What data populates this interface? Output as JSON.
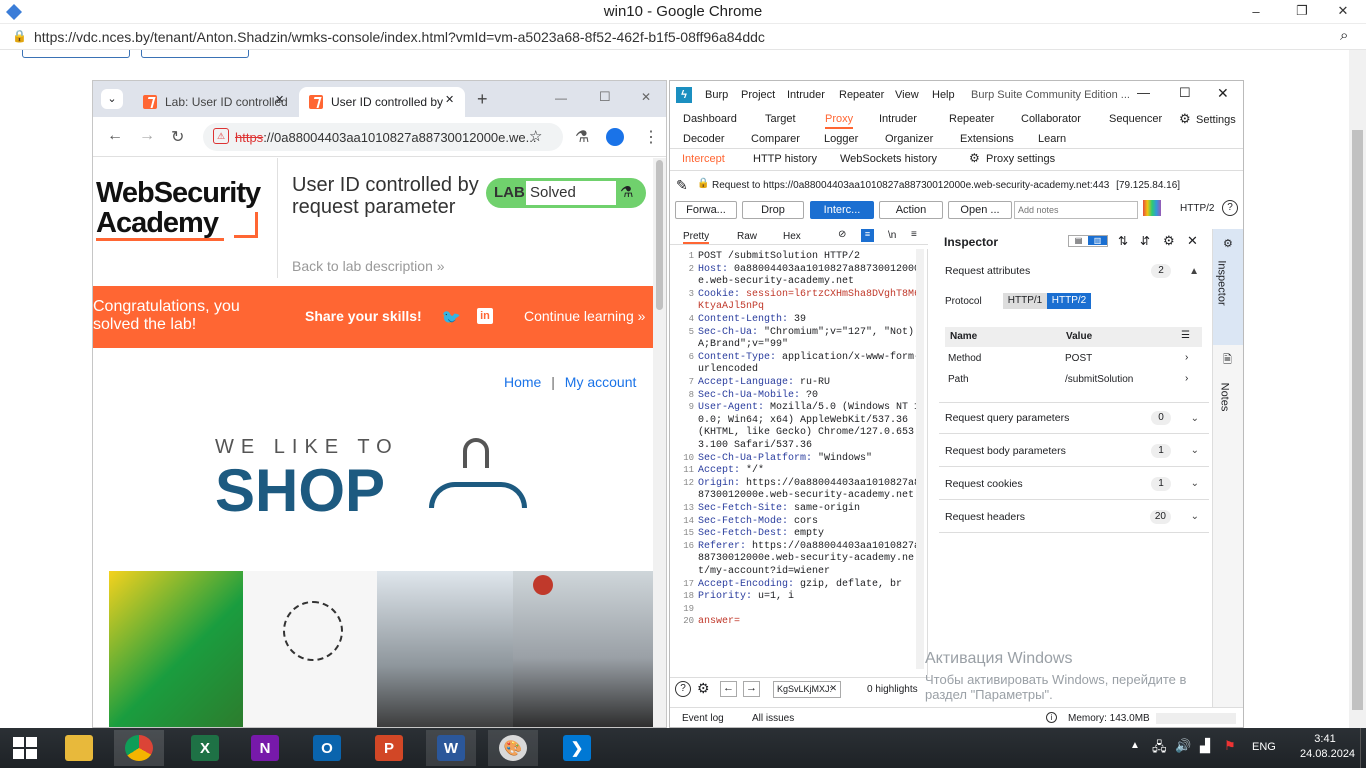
{
  "outer_window": {
    "title": "win10 - Google Chrome",
    "url": "https://vdc.nces.by/tenant/Anton.Shadzin/wmks-console/index.html?vmId=vm-a5023a68-8f52-462f-b1f5-08ff96a84ddc",
    "controls": {
      "min": "–",
      "max": "❐",
      "close": "✕"
    }
  },
  "inner_browser": {
    "tabs": [
      {
        "label": "Lab: User ID controlled"
      },
      {
        "label": "User ID controlled by"
      }
    ],
    "new_tab": "+",
    "url_scheme": "https",
    "url_rest": "://0a88004403aa1010827a88730012000e.we...",
    "page": {
      "logo_line1": "WebSecurity",
      "logo_line2": "Academy",
      "lab_title": "User ID controlled by request parameter",
      "lab_badge": "LAB",
      "lab_status": "Solved",
      "back_link": "Back to lab description",
      "congrats": "Congratulations, you solved the lab!",
      "share": "Share your skills!",
      "continue": "Continue learning",
      "nav_home": "Home",
      "nav_sep": "|",
      "nav_account": "My account",
      "shop_small": "WE LIKE TO",
      "shop_big": "SHOP"
    }
  },
  "burp": {
    "menu": [
      "Burp",
      "Project",
      "Intruder",
      "Repeater",
      "View",
      "Help"
    ],
    "window_title": "Burp Suite Community Edition ...",
    "main_tabs": [
      "Dashboard",
      "Target",
      "Proxy",
      "Intruder",
      "Repeater",
      "Collaborator",
      "Sequencer",
      "Decoder",
      "Comparer",
      "Logger",
      "Organizer",
      "Extensions",
      "Learn"
    ],
    "settings": "Settings",
    "proxy_tabs": [
      "Intercept",
      "HTTP history",
      "WebSockets history"
    ],
    "proxy_settings": "Proxy settings",
    "request_line": "Request to https://0a88004403aa1010827a88730012000e.web-security-academy.net:443",
    "request_ip": "[79.125.84.16]",
    "buttons": {
      "forward": "Forwa...",
      "drop": "Drop",
      "intercept": "Interc...",
      "action": "Action",
      "open": "Open ..."
    },
    "notes_placeholder": "Add notes",
    "http_version": "HTTP/2",
    "editor_tabs": [
      "Pretty",
      "Raw",
      "Hex"
    ],
    "newline_toggle": "\\n",
    "request_lines": [
      {
        "n": "1",
        "text": "POST /submitSolution HTTP/2"
      },
      {
        "n": "2",
        "key": "Host:",
        "val": "0a88004403aa1010827a88730012000e.web-security-academy.net"
      },
      {
        "n": "3",
        "key": "Cookie:",
        "val": "session=l6rtzCXHmSha8DVghT8M6KtyaAJl5nPq"
      },
      {
        "n": "4",
        "key": "Content-Length:",
        "val": "39"
      },
      {
        "n": "5",
        "key": "Sec-Ch-Ua:",
        "val": "\"Chromium\";v=\"127\", \"Not)A;Brand\";v=\"99\""
      },
      {
        "n": "6",
        "key": "Content-Type:",
        "val": "application/x-www-form-urlencoded"
      },
      {
        "n": "7",
        "key": "Accept-Language:",
        "val": "ru-RU"
      },
      {
        "n": "8",
        "key": "Sec-Ch-Ua-Mobile:",
        "val": "?0"
      },
      {
        "n": "9",
        "key": "User-Agent:",
        "val": "Mozilla/5.0 (Windows NT 10.0; Win64; x64) AppleWebKit/537.36 (KHTML, like Gecko) Chrome/127.0.6533.100 Safari/537.36"
      },
      {
        "n": "10",
        "key": "Sec-Ch-Ua-Platform:",
        "val": "\"Windows\""
      },
      {
        "n": "11",
        "key": "Accept:",
        "val": "*/*"
      },
      {
        "n": "12",
        "key": "Origin:",
        "val": "https://0a88004403aa1010827a88730012000e.web-security-academy.net"
      },
      {
        "n": "13",
        "key": "Sec-Fetch-Site:",
        "val": "same-origin"
      },
      {
        "n": "14",
        "key": "Sec-Fetch-Mode:",
        "val": "cors"
      },
      {
        "n": "15",
        "key": "Sec-Fetch-Dest:",
        "val": "empty"
      },
      {
        "n": "16",
        "key": "Referer:",
        "val": "https://0a88004403aa1010827a88730012000e.web-security-academy.net/my-account?id=wiener"
      },
      {
        "n": "17",
        "key": "Accept-Encoding:",
        "val": "gzip, deflate, br"
      },
      {
        "n": "18",
        "key": "Priority:",
        "val": "u=1, i"
      },
      {
        "n": "19",
        "text": ""
      },
      {
        "n": "20",
        "text": "answer="
      }
    ],
    "search_value": "KgSvLKjMXJ:",
    "highlights": "0 highlights",
    "inspector": {
      "title": "Inspector",
      "sections": [
        {
          "label": "Request attributes",
          "count": "2"
        },
        {
          "label": "Request query parameters",
          "count": "0"
        },
        {
          "label": "Request body parameters",
          "count": "1"
        },
        {
          "label": "Request cookies",
          "count": "1"
        },
        {
          "label": "Request headers",
          "count": "20"
        }
      ],
      "protocol_label": "Protocol",
      "protocol_options": [
        "HTTP/1",
        "HTTP/2"
      ],
      "table_headers": [
        "Name",
        "Value"
      ],
      "rows": [
        {
          "name": "Method",
          "value": "POST"
        },
        {
          "name": "Path",
          "value": "/submitSolution"
        }
      ]
    },
    "side_tabs": [
      "Inspector",
      "Notes"
    ],
    "status": {
      "event_log": "Event log",
      "all_issues": "All issues",
      "memory": "Memory: 143.0MB"
    }
  },
  "watermark": {
    "title": "Активация Windows",
    "line1": "Чтобы активировать Windows, перейдите в",
    "line2": "раздел \"Параметры\"."
  },
  "taskbar": {
    "lang": "ENG",
    "time": "3:41",
    "date": "24.08.2024",
    "apps": [
      "file-explorer",
      "chrome",
      "excel",
      "onenote",
      "outlook",
      "powerpoint",
      "word",
      "paint",
      "vscode"
    ]
  },
  "colors": {
    "accent_orange": "#ff6633",
    "burp_orange": "#ff6633",
    "blue_link": "#1a73e8",
    "solved_green": "#70d16d"
  }
}
